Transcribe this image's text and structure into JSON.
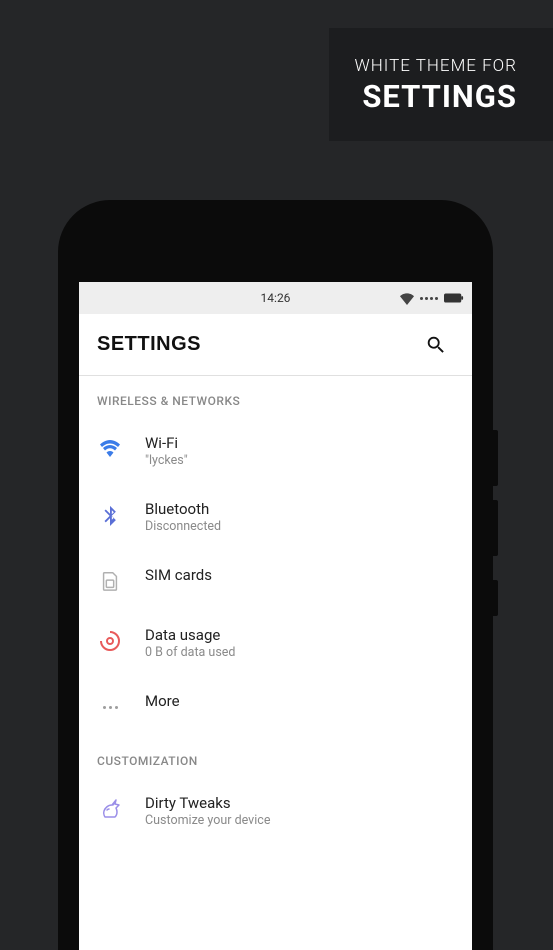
{
  "promo": {
    "line1": "WHITE THEME FOR",
    "line2": "SETTINGS"
  },
  "statusbar": {
    "time": "14:26"
  },
  "appbar": {
    "title": "SETTINGS"
  },
  "sections": {
    "wireless": {
      "header": "WIRELESS & NETWORKS"
    },
    "custom": {
      "header": "CUSTOMIZATION"
    }
  },
  "items": {
    "wifi": {
      "label": "Wi-Fi",
      "sub": "\"lyckes\""
    },
    "bluetooth": {
      "label": "Bluetooth",
      "sub": "Disconnected"
    },
    "sim": {
      "label": "SIM cards"
    },
    "data": {
      "label": "Data usage",
      "sub": "0 B of data used"
    },
    "more": {
      "label": "More"
    },
    "dirty": {
      "label": "Dirty Tweaks",
      "sub": "Customize your device"
    }
  },
  "colors": {
    "wifi": "#3b7ce8",
    "bluetooth": "#5a6fd6",
    "sim": "#b0b0b0",
    "data": "#e85a5a",
    "unicorn": "#9a8ee8"
  }
}
